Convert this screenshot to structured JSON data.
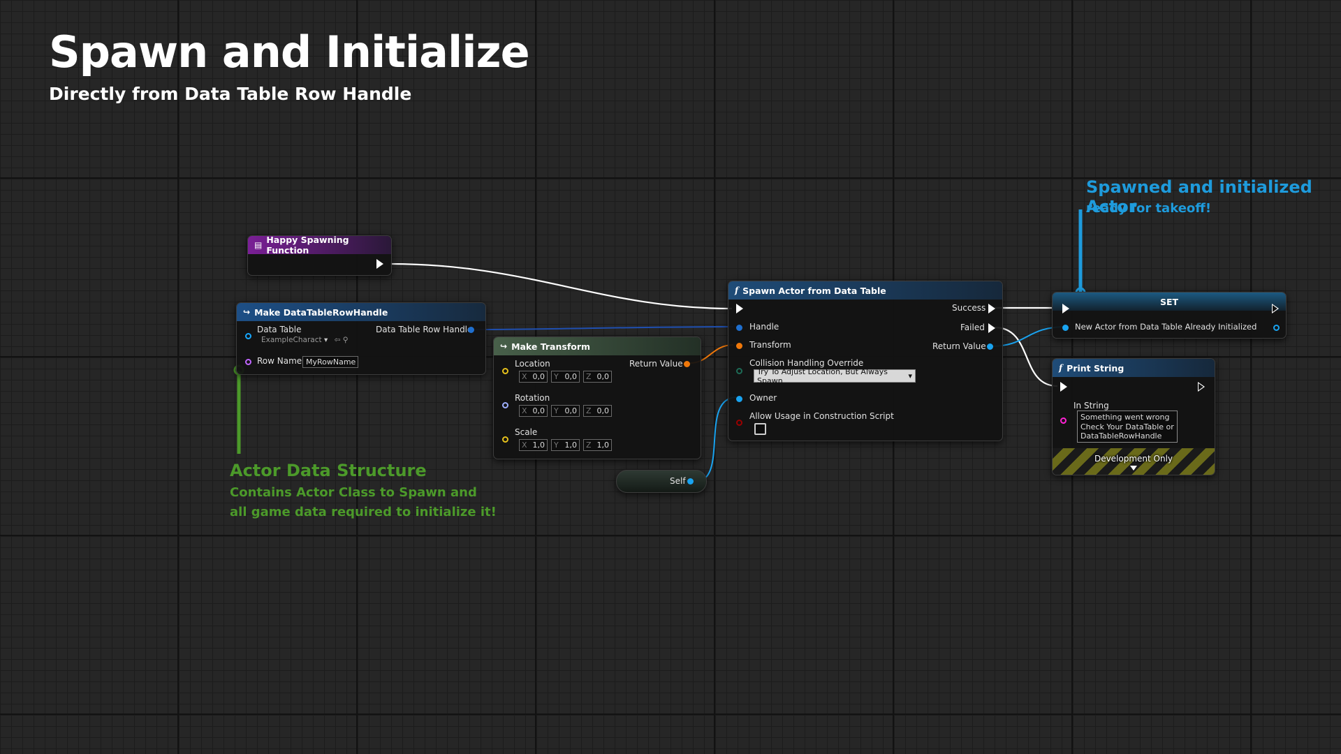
{
  "title": "Spawn and Initialize",
  "subtitle": "Directly from Data Table Row Handle",
  "comments": {
    "spawned_title": "Spawned and initialized Actor",
    "spawned_sub": "ready for takeoff!",
    "actor_data_title": "Actor Data Structure",
    "actor_data_line1": "Contains Actor Class to Spawn and",
    "actor_data_line2": "all game data required to initialize it!"
  },
  "event_node": {
    "title": "Happy Spawning Function"
  },
  "make_handle": {
    "title": "Make DataTableRowHandle",
    "data_table_label": "Data Table",
    "data_table_value": "ExampleCharact",
    "output_label": "Data Table Row Handle",
    "row_name_label": "Row Name",
    "row_name_value": "MyRowName"
  },
  "make_transform": {
    "title": "Make Transform",
    "return_label": "Return Value",
    "location_label": "Location",
    "rotation_label": "Rotation",
    "scale_label": "Scale",
    "axis_x": "X",
    "axis_y": "Y",
    "axis_z": "Z",
    "location": [
      "0,0",
      "0,0",
      "0,0"
    ],
    "rotation": [
      "0,0",
      "0,0",
      "0,0"
    ],
    "scale": [
      "1,0",
      "1,0",
      "1,0"
    ]
  },
  "self_node": {
    "label": "Self"
  },
  "spawn_node": {
    "title": "Spawn Actor from Data Table",
    "handle_label": "Handle",
    "transform_label": "Transform",
    "collision_label": "Collision Handling Override",
    "collision_value": "Try To Adjust Location, But Always Spawn",
    "owner_label": "Owner",
    "allow_label": "Allow Usage in Construction Script",
    "success_label": "Success",
    "failed_label": "Failed",
    "return_label": "Return Value"
  },
  "set_node": {
    "title": "SET",
    "var_label": "New Actor from Data Table Already Initialized"
  },
  "print_node": {
    "title": "Print String",
    "in_string_label": "In String",
    "line1": "Something went wrong",
    "line2": "Check Your DataTable or",
    "line3": "DataTableRowHandle",
    "dev_label": "Development Only"
  },
  "colors": {
    "exec": "#ffffff",
    "struct_pin": "#1f6fcf",
    "object_pin": "#19a3f0",
    "transform_pin": "#f0780a",
    "rotator_pin": "#9fb0ff",
    "name_pin": "#c066ff",
    "string_pin": "#ff22d4",
    "bool_pin": "#9a0000",
    "comment_green": "#4c9a2a",
    "comment_blue": "#1e9bdc"
  },
  "icons": {
    "event": "event-icon",
    "make_struct": "make-struct-icon",
    "function": "function-icon"
  }
}
